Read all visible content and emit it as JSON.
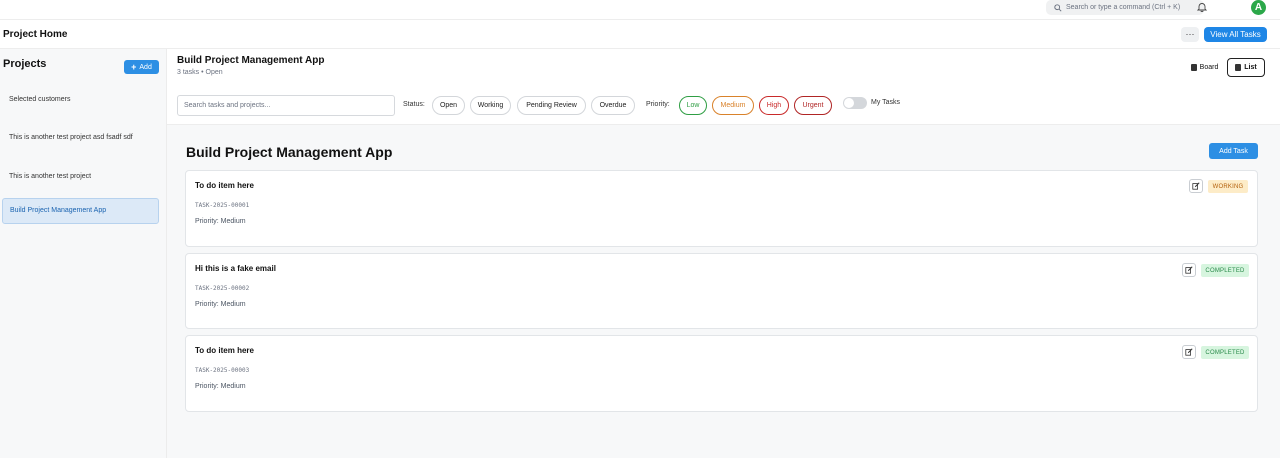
{
  "topbar": {
    "search_placeholder": "Search or type a command (Ctrl + K)",
    "avatar_letter": "A"
  },
  "header": {
    "title": "Project Home",
    "more_label": "···",
    "view_all_label": "View All Tasks"
  },
  "sidebar": {
    "title": "Projects",
    "add_label": "Add",
    "items": [
      {
        "label": "Selected customers"
      },
      {
        "label": "This is another test project asd fsadf sdf"
      },
      {
        "label": "This is another test project"
      },
      {
        "label": "Build Project Management App"
      }
    ]
  },
  "project": {
    "title": "Build Project Management App",
    "subtitle": "3 tasks • Open",
    "view_board": "Board",
    "view_list": "List"
  },
  "filters": {
    "search_placeholder": "Search tasks and projects...",
    "status_label": "Status:",
    "status_options": [
      "Open",
      "Working",
      "Pending Review",
      "Overdue"
    ],
    "priority_label": "Priority:",
    "priority_options": [
      "Low",
      "Medium",
      "High",
      "Urgent"
    ],
    "my_tasks_label": "My Tasks"
  },
  "content": {
    "title": "Build Project Management App",
    "add_task_label": "Add Task",
    "tasks": [
      {
        "title": "To do item here",
        "id": "TASK-2025-00001",
        "priority": "Priority: Medium",
        "status": "WORKING"
      },
      {
        "title": "Hi this is a fake email",
        "id": "TASK-2025-00002",
        "priority": "Priority: Medium",
        "status": "COMPLETED"
      },
      {
        "title": "To do item here",
        "id": "TASK-2025-00003",
        "priority": "Priority: Medium",
        "status": "COMPLETED"
      }
    ]
  },
  "colors": {
    "primary": "#2d8fe4",
    "working_bg": "#fdecc8",
    "working_text": "#b25e09",
    "completed_bg": "#d7f5df",
    "completed_text": "#2a8a4a",
    "low": "#2f9e44",
    "medium": "#d9822b",
    "high": "#c92a2a",
    "urgent": "#b02525"
  }
}
